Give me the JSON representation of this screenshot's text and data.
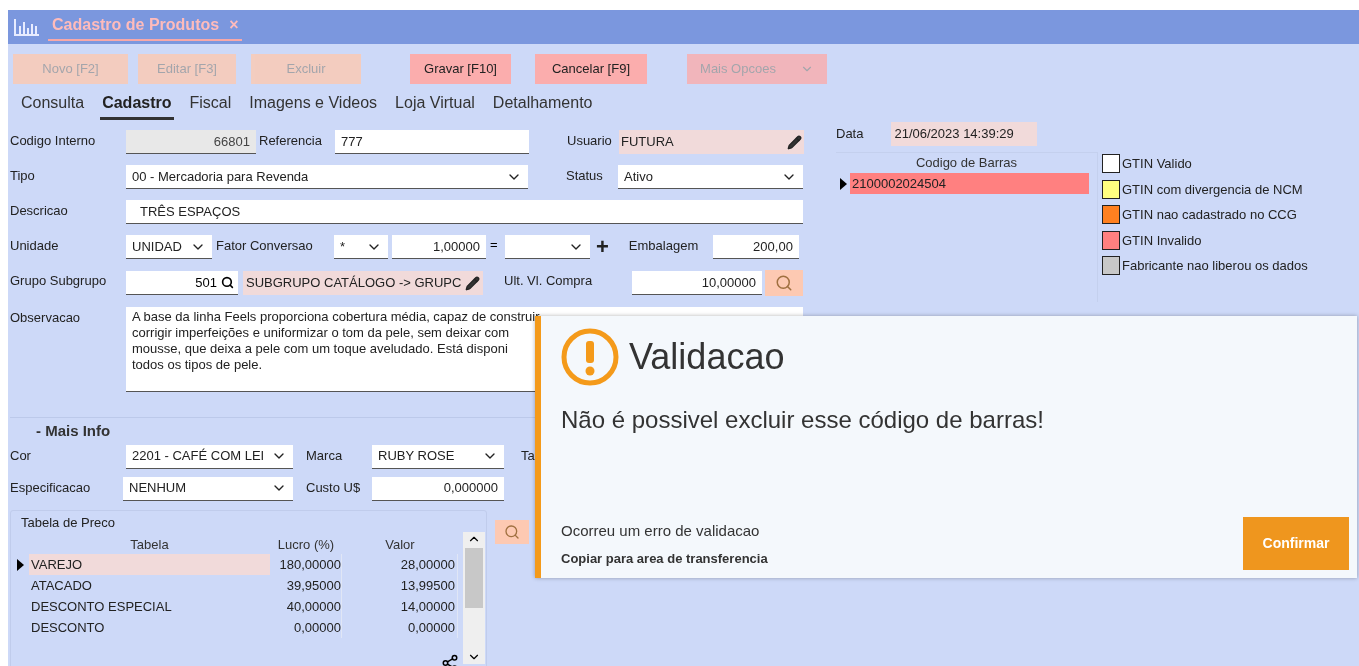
{
  "window": {
    "title": "Cadastro de Produtos",
    "close": "×"
  },
  "toolbar": [
    {
      "label": "Novo [F2]",
      "disabled": true,
      "kind": "plain"
    },
    {
      "label": "Editar [F3]",
      "disabled": true,
      "kind": "plain"
    },
    {
      "label": "Excluir",
      "disabled": true,
      "kind": "plain"
    },
    {
      "label": "Gravar [F10]",
      "disabled": false,
      "kind": "plain"
    },
    {
      "label": "Cancelar [F9]",
      "disabled": false,
      "kind": "plain"
    },
    {
      "label": "Mais Opcoes",
      "disabled": true,
      "kind": "dropdown"
    }
  ],
  "tabs": [
    {
      "label": "Consulta",
      "selected": false
    },
    {
      "label": "Cadastro",
      "selected": true
    },
    {
      "label": "Fiscal",
      "selected": false
    },
    {
      "label": "Imagens e Videos",
      "selected": false
    },
    {
      "label": "Loja Virtual",
      "selected": false
    },
    {
      "label": "Detalhamento",
      "selected": false
    }
  ],
  "form": {
    "codigo_interno": {
      "label": "Codigo Interno",
      "value": "66801"
    },
    "referencia": {
      "label": "Referencia",
      "value": "777"
    },
    "usuario": {
      "label": "Usuario",
      "value": "FUTURA"
    },
    "tipo": {
      "label": "Tipo",
      "value": "00 - Mercadoria para Revenda"
    },
    "status": {
      "label": "Status",
      "value": "Ativo"
    },
    "descricao": {
      "label": "Descricao",
      "value": "TRÊS ESPAÇOS"
    },
    "unidade": {
      "label": "Unidade",
      "value": "UNIDAD"
    },
    "fator_conversao": {
      "label": "Fator Conversao",
      "operator": "*",
      "value": "1,00000",
      "equals": "=",
      "plus": "+"
    },
    "embalagem": {
      "label": "Embalagem",
      "value": "200,00"
    },
    "grupo_subgrupo": {
      "label": "Grupo Subgrupo",
      "code": "501",
      "name": "SUBGRUPO CATÁLOGO -> GRUPC"
    },
    "ult_vl_compra": {
      "label": "Ult. Vl. Compra",
      "value": "10,00000"
    },
    "observacao": {
      "label": "Observacao",
      "lines": [
        "A base da linha Feels proporciona cobertura média, capaz de construir",
        "corrigir imperfeições e uniformizar o tom da pele, sem deixar com",
        "mousse, que deixa a pele com um toque aveludado. Está disponi",
        "todos os tipos de pele."
      ]
    }
  },
  "mais_info": {
    "title": "- Mais Info",
    "cor": {
      "label": "Cor",
      "value": "2201 - CAFÉ COM LEI"
    },
    "marca": {
      "label": "Marca",
      "value": "RUBY ROSE"
    },
    "column_3": {
      "label": "Ta"
    },
    "especificacao": {
      "label": "Especificacao",
      "value": "NENHUM"
    },
    "custo": {
      "label": "Custo U$",
      "value": "0,000000"
    }
  },
  "price_table": {
    "title": "Tabela de Preco",
    "columns": [
      "Tabela",
      "Lucro (%)",
      "Valor"
    ],
    "rows": [
      {
        "cells": [
          "VAREJO",
          "180,00000",
          "28,00000"
        ],
        "selected": true
      },
      {
        "cells": [
          "ATACADO",
          "39,95000",
          "13,99500"
        ],
        "selected": false
      },
      {
        "cells": [
          "DESCONTO ESPECIAL",
          "40,00000",
          "14,00000"
        ],
        "selected": false
      },
      {
        "cells": [
          "DESCONTO",
          "0,00000",
          "0,00000"
        ],
        "selected": false
      }
    ]
  },
  "data": {
    "label": "Data",
    "value": "21/06/2023 14:39:29"
  },
  "barcodes": {
    "column": "Codigo de Barras",
    "rows": [
      {
        "value": "2100002024504",
        "selected": true,
        "color": "#ff8080"
      }
    ]
  },
  "legend": [
    {
      "label": "GTIN Valido",
      "color": "#ffffff"
    },
    {
      "label": "GTIN com divergencia de NCM",
      "color": "#ffff80"
    },
    {
      "label": "GTIN nao cadastrado no CCG",
      "color": "#ff8020"
    },
    {
      "label": "GTIN Invalido",
      "color": "#ff8080"
    },
    {
      "label": "Fabricante nao liberou os dados",
      "color": "#c8c8c8"
    }
  ],
  "dialog": {
    "title": "Validacao",
    "message": "Não é possivel excluir esse código de barras!",
    "detail": "Ocorreu um erro de validacao",
    "copy_link": "Copiar para area de transferencia",
    "confirm": "Confirmar"
  }
}
